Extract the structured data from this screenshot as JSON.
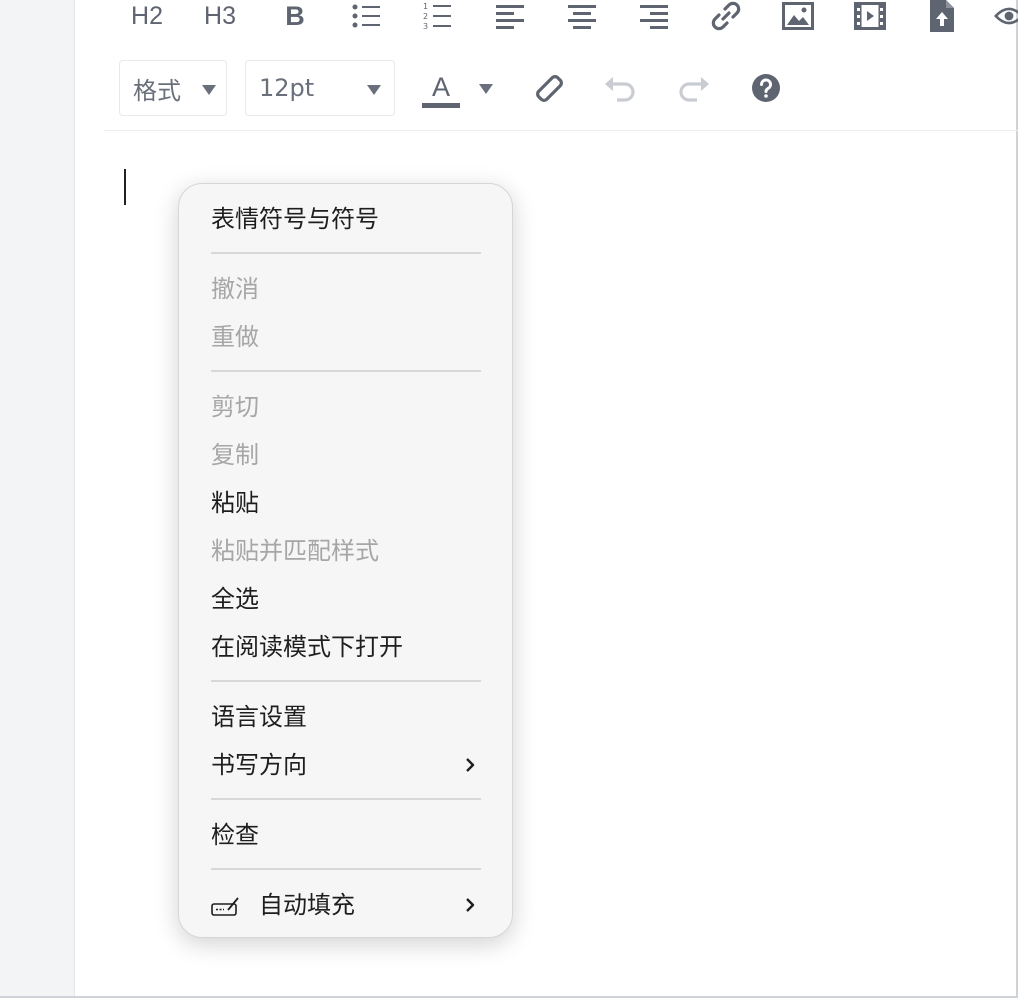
{
  "toolbar": {
    "h2_label": "H2",
    "h3_label": "H3",
    "bold_label": "B",
    "format_select": {
      "value": "格式"
    },
    "fontsize_select": {
      "value": "12pt"
    },
    "font_color_label": "A",
    "icons": [
      "bulleted-list-icon",
      "numbered-list-icon",
      "align-left-icon",
      "align-center-icon",
      "align-right-icon",
      "link-icon",
      "image-icon",
      "video-icon",
      "upload-file-icon",
      "preview-eye-icon",
      "eraser-icon",
      "undo-icon",
      "redo-icon",
      "help-icon"
    ],
    "colors": {
      "icon": "#5e6470",
      "disabled_icon": "#c9ccd1",
      "help_bg": "#5e6470"
    }
  },
  "context_menu": {
    "items": [
      {
        "label": "表情符号与符号",
        "enabled": true
      },
      {
        "label": "撤消",
        "enabled": false
      },
      {
        "label": "重做",
        "enabled": false
      },
      {
        "label": "剪切",
        "enabled": false
      },
      {
        "label": "复制",
        "enabled": false
      },
      {
        "label": "粘贴",
        "enabled": true
      },
      {
        "label": "粘贴并匹配样式",
        "enabled": false
      },
      {
        "label": "全选",
        "enabled": true
      },
      {
        "label": "在阅读模式下打开",
        "enabled": true
      },
      {
        "label": "语言设置",
        "enabled": true
      },
      {
        "label": "书写方向",
        "enabled": true,
        "submenu": true
      },
      {
        "label": "检查",
        "enabled": true
      },
      {
        "label": "自动填充",
        "enabled": true,
        "submenu": true,
        "icon": "autofill-pen-icon"
      }
    ],
    "colors": {
      "bg": "#f6f6f6",
      "text": "#1e1e1e",
      "disabled_text": "#a6a6a6"
    }
  }
}
